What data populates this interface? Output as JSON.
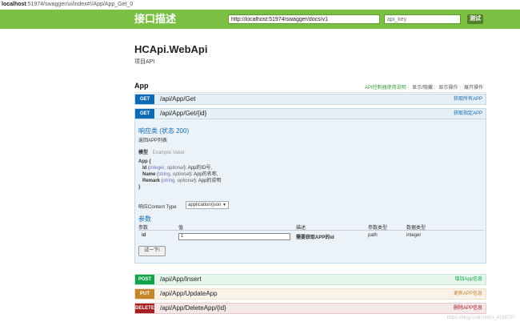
{
  "browser": {
    "url_host": "localhost",
    "url_rest": ":51974/swagger/ui/index#!/App/App_Get_0"
  },
  "header": {
    "title": "接口描述",
    "docs_url": "http://localhost:51974/swagger/docs/v1",
    "api_key_placeholder": "api_key",
    "explore_label": "测试"
  },
  "api": {
    "title": "HCApi.WebApi",
    "subtitle": "项目API"
  },
  "section": {
    "name": "App",
    "links": [
      "API控制器使用说明",
      "显示/隐藏",
      "显示操作",
      "展开操作"
    ]
  },
  "operations": [
    {
      "method": "GET",
      "path": "/api/App/Get",
      "desc": "获取所有APP"
    },
    {
      "method": "GET",
      "path": "/api/App/Get/{id}",
      "desc": "获取指定APP"
    },
    {
      "method": "POST",
      "path": "/api/App/Insert",
      "desc": "增加App信息"
    },
    {
      "method": "PUT",
      "path": "/api/App/UpdateApp",
      "desc": "更新APP信息"
    },
    {
      "method": "DELETE",
      "path": "/api/App/DeleteApp/{id}",
      "desc": "删除APP信息"
    }
  ],
  "detail": {
    "response_heading": "响应类 (状态 200)",
    "response_sub": "返回APP列表",
    "model_tab": "模型",
    "example_tab": "Example Value",
    "model": {
      "name": "App {",
      "fields": [
        {
          "name": "Id",
          "type": "integer",
          "opt": ", optional",
          "desc": "App的ID号,"
        },
        {
          "name": "Name",
          "type": "string",
          "opt": ", optional",
          "desc": "App的名称,"
        },
        {
          "name": "Remark",
          "type": "string",
          "opt": ", optional",
          "desc": "App的说明"
        }
      ],
      "close": "}"
    },
    "content_type_label": "响应Content Type",
    "content_type_value": "application/json",
    "params_heading": "参数",
    "param_columns": [
      "参数",
      "值",
      "描述",
      "参数类型",
      "数据类型"
    ],
    "param_row": {
      "name": "id",
      "value": "1",
      "desc": "需要获取APP的id",
      "param_type": "path",
      "data_type": "integer"
    },
    "try_label": "试一下!"
  },
  "watermark": "https://blog.csdn.net/u_4169797"
}
